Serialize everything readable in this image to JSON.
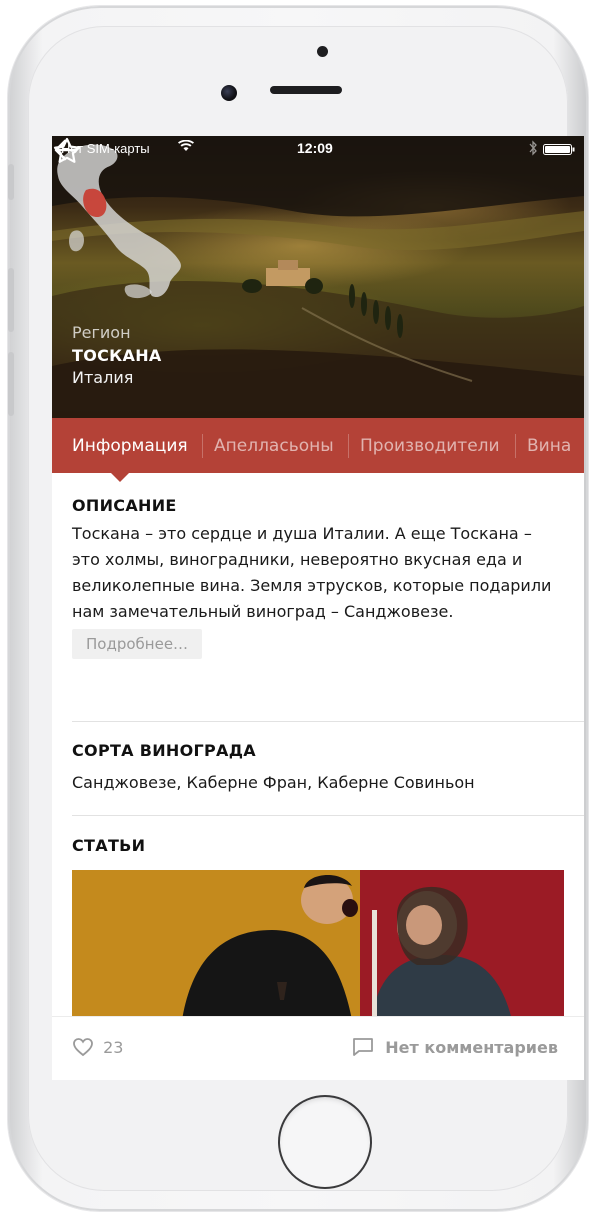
{
  "status_bar": {
    "carrier": "Нет SIM-карты",
    "time": "12:09"
  },
  "hero": {
    "kind": "Регион",
    "name": "ТОСКАНА",
    "country": "Италия"
  },
  "tabs": [
    {
      "label": "Информация",
      "active": true
    },
    {
      "label": "Апелласьоны",
      "active": false
    },
    {
      "label": "Производители",
      "active": false
    },
    {
      "label": "Вина",
      "active": false
    }
  ],
  "description": {
    "title": "ОПИСАНИЕ",
    "text": "Тоскана – это сердце и душа Италии. А еще Тоскана – это холмы, виноградники, невероятно вкусная еда и великолепные вина. Земля этрусков, которые подарили нам замечательный виноград – Санджовезе.",
    "more_label": "Подробнее…"
  },
  "grapes": {
    "title": "СОРТА ВИНОГРАДА",
    "text": "Санджовезе, Каберне Фран, Каберне Совиньон"
  },
  "articles": {
    "title": "СТАТЬИ"
  },
  "footer": {
    "likes_count": "23",
    "comments_label": "Нет комментариев"
  },
  "colors": {
    "accent": "#b44237",
    "muted_text": "#9a9a9a"
  }
}
